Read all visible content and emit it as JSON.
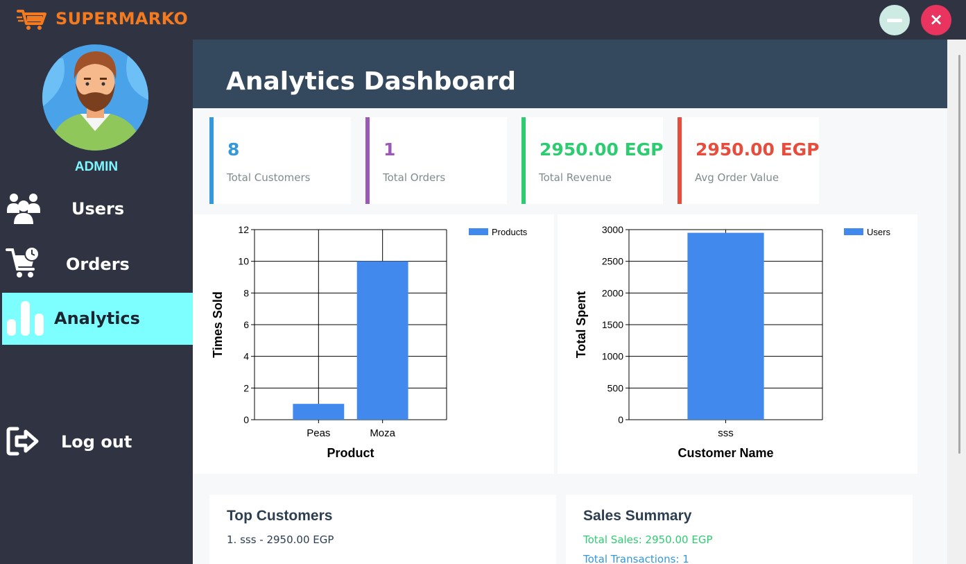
{
  "app": {
    "title": "SUPERMARKO",
    "logo_icon": "shopping-cart-icon",
    "brand_color": "#f47a1f"
  },
  "window": {
    "minimize_icon": "minimize-icon",
    "close_icon": "close-icon",
    "close_glyph": "×"
  },
  "sidebar": {
    "user_role": "ADMIN",
    "avatar_icon": "bearded-man-avatar",
    "items": [
      {
        "label": "Users",
        "icon": "users-icon",
        "active": false
      },
      {
        "label": "Orders",
        "icon": "cart-clock-icon",
        "active": false
      },
      {
        "label": "Analytics",
        "icon": "bar-chart-icon",
        "active": true
      },
      {
        "label": "Log out",
        "icon": "logout-icon",
        "active": false
      }
    ],
    "active_color": "#7dffff"
  },
  "main": {
    "title": "Analytics Dashboard",
    "stats": [
      {
        "value": "8",
        "label": "Total Customers",
        "color": "#3498db"
      },
      {
        "value": "1",
        "label": "Total Orders",
        "color": "#9b59b6"
      },
      {
        "value": "2950.00 EGP",
        "label": "Total Revenue",
        "color": "#2ecc71"
      },
      {
        "value": "2950.00 EGP",
        "label": "Avg Order Value",
        "color": "#e74c3c"
      }
    ],
    "top_customers": {
      "title": "Top Customers",
      "lines": [
        "1. sss - 2950.00 EGP"
      ]
    },
    "sales_summary": {
      "title": "Sales Summary",
      "lines": [
        "Total Sales: 2950.00 EGP",
        "Total Transactions: 1"
      ]
    }
  },
  "chart_data": [
    {
      "type": "bar",
      "categories": [
        "Peas",
        "Moza"
      ],
      "series": [
        {
          "name": "Products",
          "values": [
            1,
            10
          ]
        }
      ],
      "xlabel": "Product",
      "ylabel": "Times Sold",
      "ylim": [
        0,
        12
      ],
      "yticks": [
        0,
        2,
        4,
        6,
        8,
        10,
        12
      ],
      "grid": true,
      "legend": "top-right",
      "color": "#4189ec"
    },
    {
      "type": "bar",
      "categories": [
        "sss"
      ],
      "series": [
        {
          "name": "Users",
          "values": [
            2950
          ]
        }
      ],
      "xlabel": "Customer Name",
      "ylabel": "Total Spent",
      "ylim": [
        0,
        3000
      ],
      "yticks": [
        0,
        500,
        1000,
        1500,
        2000,
        2500,
        3000
      ],
      "grid": true,
      "legend": "top-right",
      "color": "#4189ec"
    }
  ]
}
